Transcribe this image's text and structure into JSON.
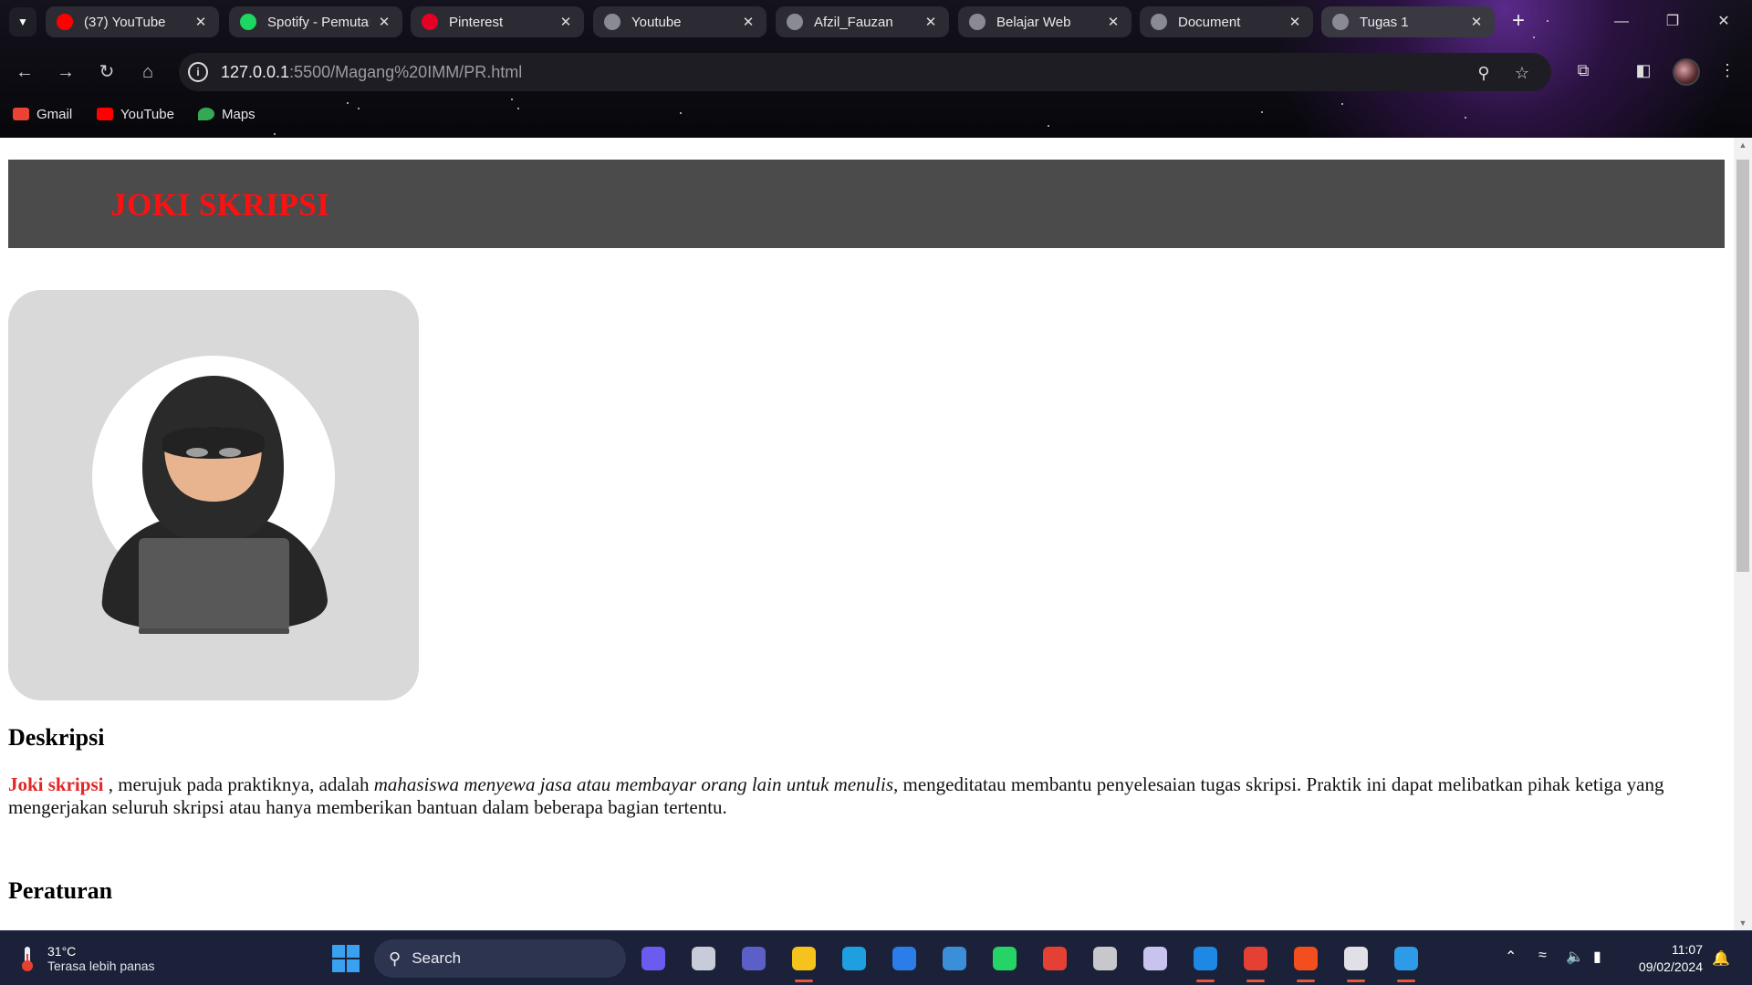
{
  "browser": {
    "tabs": [
      {
        "title": "(37) YouTube",
        "favicon": "youtube-icon",
        "color": "#ff0000",
        "active": false
      },
      {
        "title": "Spotify - Pemutar",
        "favicon": "spotify-icon",
        "color": "#1ed760",
        "active": false
      },
      {
        "title": "Pinterest",
        "favicon": "pinterest-icon",
        "color": "#e60023",
        "active": false
      },
      {
        "title": "Youtube",
        "favicon": "globe-icon",
        "color": "#8a8a95",
        "active": false
      },
      {
        "title": "Afzil_Fauzan",
        "favicon": "globe-icon",
        "color": "#8a8a95",
        "active": false
      },
      {
        "title": "Belajar Web",
        "favicon": "globe-icon",
        "color": "#8a8a95",
        "active": false
      },
      {
        "title": "Document",
        "favicon": "globe-icon",
        "color": "#8a8a95",
        "active": false
      },
      {
        "title": "Tugas 1",
        "favicon": "globe-icon",
        "color": "#8a8a95",
        "active": true
      }
    ],
    "address": {
      "host": "127.0.0.1",
      "path": ":5500/Magang%20IMM/PR.html"
    },
    "bookmarks": [
      {
        "label": "Gmail",
        "icon": "gmail-icon"
      },
      {
        "label": "YouTube",
        "icon": "youtube-icon"
      },
      {
        "label": "Maps",
        "icon": "maps-icon"
      }
    ]
  },
  "page": {
    "header_title": "JOKI SKRIPSI",
    "hero_image": "hooded-hacker-laptop-illustration",
    "description": {
      "heading": "Deskripsi",
      "highlight": "Joki skripsi",
      "text_before_italic": " , merujuk pada praktiknya, adalah ",
      "italic": "mahasiswa menyewa jasa atau membayar orang lain untuk menulis",
      "text_after_italic": ", mengeditatau membantu penyelesaian tugas skripsi. Praktik ini dapat melibatkan pihak ketiga yang mengerjakan seluruh skripsi atau hanya memberikan bantuan dalam beberapa bagian tertentu."
    },
    "rules_heading": "Peraturan"
  },
  "taskbar": {
    "weather": {
      "temp": "31°C",
      "condition": "Terasa lebih panas"
    },
    "search_label": "Search",
    "apps": [
      "copilot-icon",
      "task-view-icon",
      "teams-icon",
      "file-explorer-icon",
      "edge-icon",
      "defender-icon",
      "store-icon",
      "whatsapp-icon",
      "chrome-icon",
      "app-icon",
      "heroku-icon",
      "vscode-icon",
      "chrome-profile-icon",
      "figma-icon",
      "media-player-icon",
      "photos-icon"
    ],
    "time": "11:07",
    "date": "09/02/2024"
  },
  "colors": {
    "header_bg": "#4b4b4b",
    "header_text": "#ff1010",
    "highlight": "#e32626",
    "card_bg": "#d9d9d9"
  }
}
